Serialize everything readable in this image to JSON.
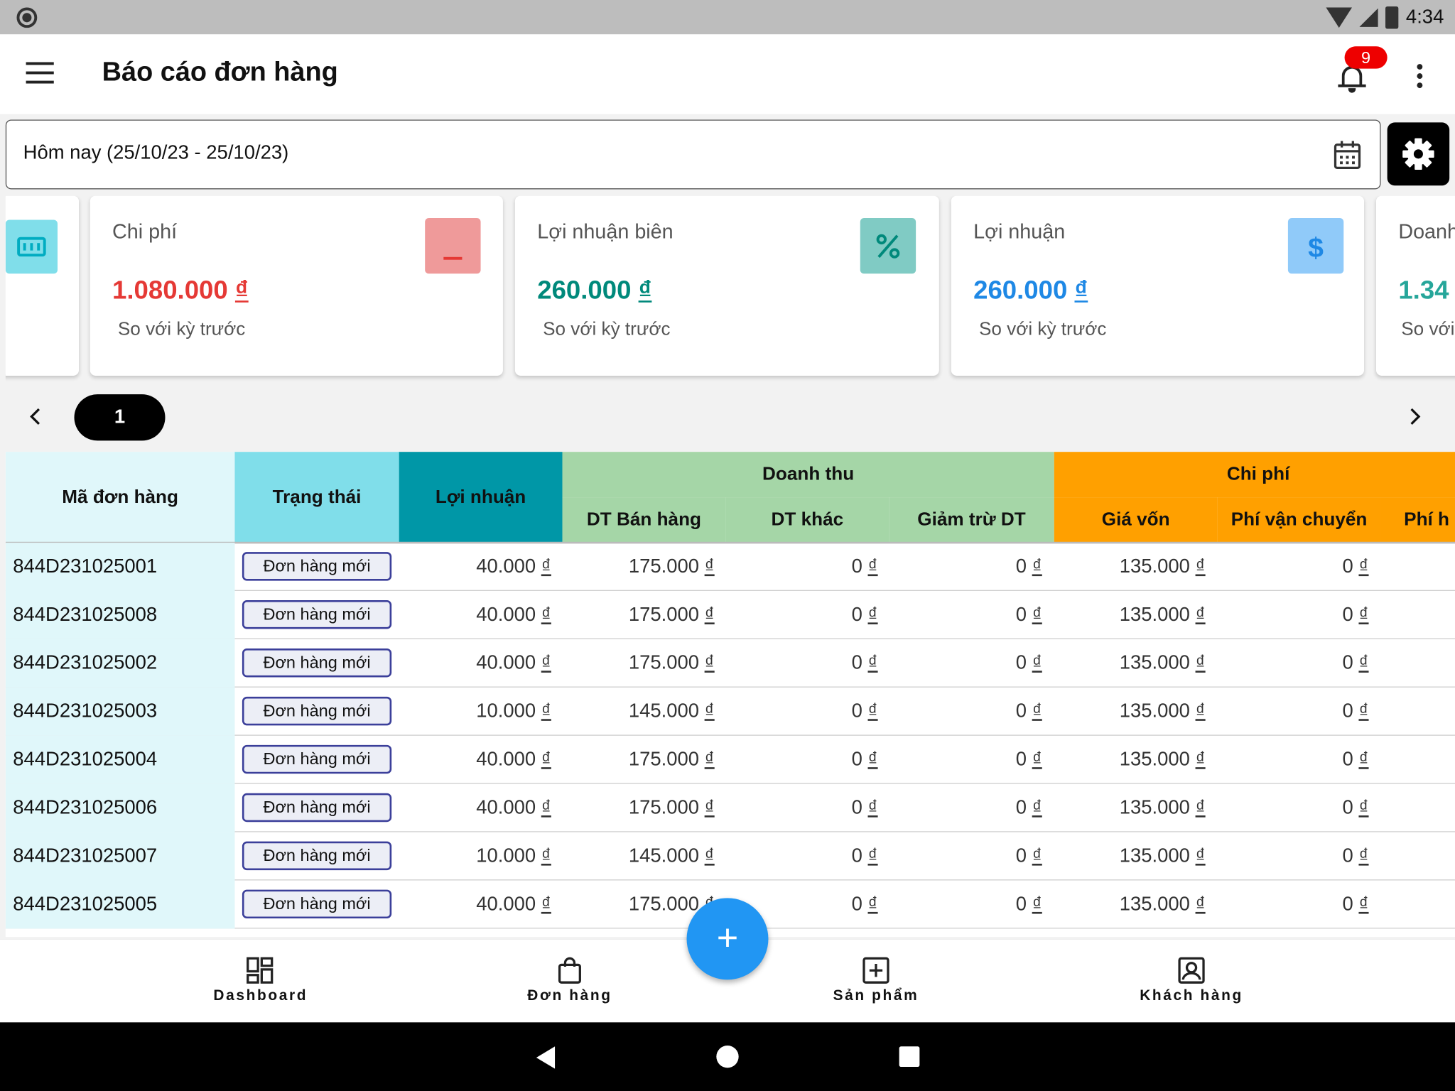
{
  "statusbar": {
    "time": "4:34"
  },
  "appbar": {
    "title": "Báo cáo đơn hàng",
    "notification_count": "9"
  },
  "filter": {
    "date_range": "Hôm nay (25/10/23 - 25/10/23)"
  },
  "cards": [
    {
      "label": "Chi phí",
      "value": "1.080.000",
      "currency": "₫",
      "sub": "So với kỳ trước",
      "color": "#e53935",
      "icon": "minus-icon",
      "icon_bg": "#ef9a9a"
    },
    {
      "label": "Lợi nhuận biên",
      "value": "260.000",
      "currency": "₫",
      "sub": "So với kỳ trước",
      "color": "#00897b",
      "icon": "percent-icon",
      "icon_bg": "#80cbc4"
    },
    {
      "label": "Lợi nhuận",
      "value": "260.000",
      "currency": "₫",
      "sub": "So với kỳ trước",
      "color": "#1e88e5",
      "icon": "dollar-icon",
      "icon_bg": "#90caf9"
    },
    {
      "label": "Doanh",
      "value": "1.34",
      "currency": "",
      "sub": "So với",
      "color": "#26a69a",
      "icon": "",
      "icon_bg": ""
    }
  ],
  "pager": {
    "current": "1"
  },
  "table": {
    "headers": {
      "code": "Mã đơn hàng",
      "status": "Trạng thái",
      "profit": "Lợi nhuận",
      "revenue_group": "Doanh thu",
      "sales": "DT Bán hàng",
      "other": "DT khác",
      "deduct": "Giảm trừ DT",
      "cost_group": "Chi phí",
      "cogs": "Giá vốn",
      "shipping": "Phí vận chuyển",
      "fee": "Phí h"
    },
    "currency": "₫",
    "rows": [
      {
        "code": "844D231025001",
        "status": "Đơn hàng mới",
        "profit": "40.000",
        "sales": "175.000",
        "other": "0",
        "deduct": "0",
        "cogs": "135.000",
        "shipping": "0"
      },
      {
        "code": "844D231025008",
        "status": "Đơn hàng mới",
        "profit": "40.000",
        "sales": "175.000",
        "other": "0",
        "deduct": "0",
        "cogs": "135.000",
        "shipping": "0"
      },
      {
        "code": "844D231025002",
        "status": "Đơn hàng mới",
        "profit": "40.000",
        "sales": "175.000",
        "other": "0",
        "deduct": "0",
        "cogs": "135.000",
        "shipping": "0"
      },
      {
        "code": "844D231025003",
        "status": "Đơn hàng mới",
        "profit": "10.000",
        "sales": "145.000",
        "other": "0",
        "deduct": "0",
        "cogs": "135.000",
        "shipping": "0"
      },
      {
        "code": "844D231025004",
        "status": "Đơn hàng mới",
        "profit": "40.000",
        "sales": "175.000",
        "other": "0",
        "deduct": "0",
        "cogs": "135.000",
        "shipping": "0"
      },
      {
        "code": "844D231025006",
        "status": "Đơn hàng mới",
        "profit": "40.000",
        "sales": "175.000",
        "other": "0",
        "deduct": "0",
        "cogs": "135.000",
        "shipping": "0"
      },
      {
        "code": "844D231025007",
        "status": "Đơn hàng mới",
        "profit": "10.000",
        "sales": "145.000",
        "other": "0",
        "deduct": "0",
        "cogs": "135.000",
        "shipping": "0"
      },
      {
        "code": "844D231025005",
        "status": "Đơn hàng mới",
        "profit": "40.000",
        "sales": "175.000",
        "other": "0",
        "deduct": "0",
        "cogs": "135.000",
        "shipping": "0"
      }
    ]
  },
  "fab": {
    "label": "+"
  },
  "bottomnav": [
    {
      "label": "Dashboard",
      "icon": "dashboard-icon"
    },
    {
      "label": "Đơn hàng",
      "icon": "shopping-bag-icon"
    },
    {
      "label": "Sản phẩm",
      "icon": "add-box-icon"
    },
    {
      "label": "Khách hàng",
      "icon": "account-box-icon"
    }
  ]
}
